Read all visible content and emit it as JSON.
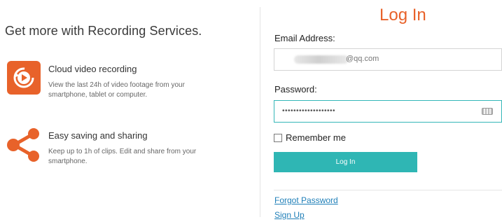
{
  "promo": {
    "headline": "Get more with Recording Services.",
    "features": [
      {
        "title": "Cloud video recording",
        "description": "View the last 24h of video footage from your smartphone, tablet or computer.",
        "icon": "cloud-recording-icon",
        "color": "#e8622a"
      },
      {
        "title": "Easy saving and sharing",
        "description": "Keep up to 1h of clips. Edit and share from your smartphone.",
        "icon": "share-icon",
        "color": "#e8622a"
      }
    ]
  },
  "login": {
    "title": "Log In",
    "email_label": "Email Address:",
    "email_value": "@qq.com",
    "password_label": "Password:",
    "password_value": "•••••••••••••••••••",
    "remember_label": "Remember me",
    "remember_checked": false,
    "login_button": "Log In",
    "forgot_link": "Forgot Password",
    "signup_link": "Sign Up"
  },
  "colors": {
    "accent": "#e8622a",
    "button": "#2fb6b4",
    "focus_border": "#34b7b8",
    "link": "#1f7fb8"
  }
}
